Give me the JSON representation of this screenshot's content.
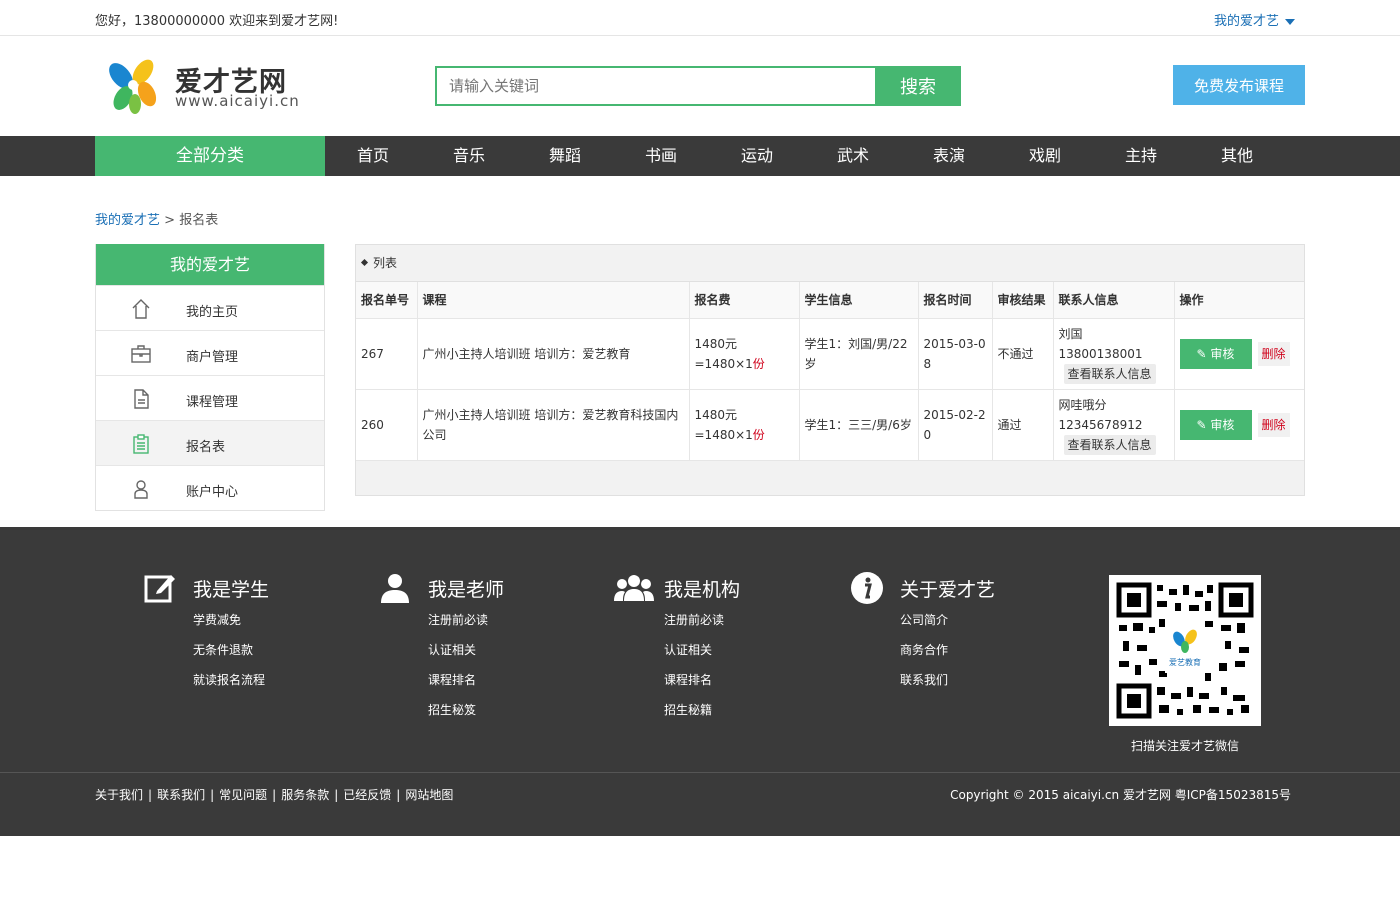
{
  "topbar": {
    "welcome": "您好，13800000000 欢迎来到爱才艺网!",
    "my_account": "我的爱才艺"
  },
  "header": {
    "brand": "爱才艺网",
    "domain": "www.aicaiyi.cn",
    "search_placeholder": "请输入关键词",
    "search_button": "搜索",
    "publish_button": "免费发布课程"
  },
  "nav": {
    "all_categories": "全部分类",
    "items": [
      "首页",
      "音乐",
      "舞蹈",
      "书画",
      "运动",
      "武术",
      "表演",
      "戏剧",
      "主持",
      "其他"
    ]
  },
  "breadcrumb": {
    "home": "我的爱才艺",
    "sep": " > ",
    "current": "报名表"
  },
  "sidebar": {
    "title": "我的爱才艺",
    "items": [
      {
        "label": "我的主页",
        "icon": "home-icon"
      },
      {
        "label": "商户管理",
        "icon": "briefcase-icon"
      },
      {
        "label": "课程管理",
        "icon": "document-icon"
      },
      {
        "label": "报名表",
        "icon": "clipboard-icon",
        "active": true
      },
      {
        "label": "账户中心",
        "icon": "user-icon"
      }
    ]
  },
  "panel": {
    "title": "列表",
    "columns": [
      "报名单号",
      "课程",
      "报名费",
      "学生信息",
      "报名时间",
      "审核结果",
      "联系人信息",
      "操作"
    ],
    "rows": [
      {
        "id": "267",
        "course": "广州小主持人培训班 培训方：爱艺教育",
        "fee": "1480元=1480×1",
        "fee_unit": "份",
        "student": "学生1：刘国/男/22岁",
        "time": "2015-03-08",
        "result": "不通过",
        "contact_name": "刘国",
        "contact_phone": "13800138001",
        "view_contact": "查看联系人信息",
        "audit": "审核",
        "delete": "删除"
      },
      {
        "id": "260",
        "course": "广州小主持人培训班 培训方：爱艺教育科技国内公司",
        "fee": "1480元=1480×1",
        "fee_unit": "份",
        "student": "学生1：三三/男/6岁",
        "time": "2015-02-20",
        "result": "通过",
        "contact_name": "网哇哦分",
        "contact_phone": "12345678912",
        "view_contact": "查看联系人信息",
        "audit": "审核",
        "delete": "删除"
      }
    ]
  },
  "footer": {
    "columns": [
      {
        "title": "我是学生",
        "icon": "edit-icon",
        "links": [
          "学费减免",
          "无条件退款",
          "就读报名流程"
        ]
      },
      {
        "title": "我是老师",
        "icon": "teacher-icon",
        "links": [
          "注册前必读",
          "认证相关",
          "课程排名",
          "招生秘笈"
        ]
      },
      {
        "title": "我是机构",
        "icon": "group-icon",
        "links": [
          "注册前必读",
          "认证相关",
          "课程排名",
          "招生秘籍"
        ]
      },
      {
        "title": "关于爱才艺",
        "icon": "info-icon",
        "links": [
          "公司简介",
          "商务合作",
          "联系我们"
        ]
      }
    ],
    "qr_caption": "扫描关注爱才艺微信",
    "qr_logo_text": "爱艺教育",
    "bottom_links": [
      "关于我们",
      "联系我们",
      "常见问题",
      "服务条款",
      "已经反馈",
      "网站地图"
    ],
    "copyright": "Copyright © 2015 aicaiyi.cn 爱才艺网 粤ICP备15023815号"
  },
  "colors": {
    "green": "#46b771",
    "blue": "#4fb2e8",
    "dark": "#3a3a3a",
    "link": "#1a6fb5",
    "red": "#d0021b"
  }
}
